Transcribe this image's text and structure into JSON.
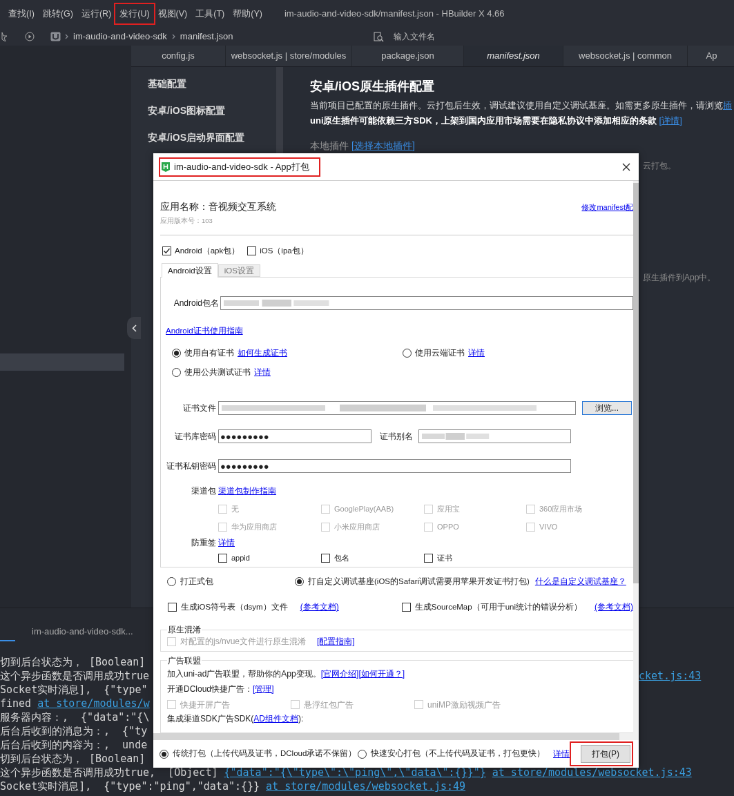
{
  "menu_bar": {
    "items": [
      {
        "label": "查找(I)",
        "highlighted": false
      },
      {
        "label": "跳转(G)",
        "highlighted": false
      },
      {
        "label": "运行(R)",
        "highlighted": false
      },
      {
        "label": "发行(U)",
        "highlighted": true
      },
      {
        "label": "视图(V)",
        "highlighted": false
      },
      {
        "label": "工具(T)",
        "highlighted": false
      },
      {
        "label": "帮助(Y)",
        "highlighted": false
      }
    ],
    "title": "im-audio-and-video-sdk/manifest.json - HBuilder X 4.66"
  },
  "toolbar": {
    "breadcrumb": [
      "im-audio-and-video-sdk",
      "manifest.json"
    ],
    "search": {
      "placeholder": "输入文件名"
    }
  },
  "editor_tabs": [
    {
      "label": "config.js",
      "selected": false
    },
    {
      "label": "websocket.js | store/modules",
      "selected": false
    },
    {
      "label": "package.json",
      "selected": false
    },
    {
      "label": "manifest.json",
      "selected": true
    },
    {
      "label": "websocket.js | common",
      "selected": false
    },
    {
      "label": "Ap",
      "selected": false
    }
  ],
  "settings_nav": {
    "items": [
      {
        "label": "基础配置"
      },
      {
        "label": "安卓/iOS图标配置"
      },
      {
        "label": "安卓/iOS启动界面配置"
      }
    ]
  },
  "content": {
    "heading": "安卓/iOS原生插件配置",
    "description": "当前项目已配置的原生插件。云打包后生效，调试建议使用自定义调试基座。如需更多原生插件，请浏览",
    "description_link": "插",
    "notice": "uni原生插件可能依赖三方SDK，上架到国内应用市场需要在隐私协议中添加相应的条款",
    "notice_link": "[详情]",
    "local_label": "本地插件",
    "local_link": "[选择本地插件]",
    "fragments": [
      "云打包。",
      "原生插件到App中。"
    ]
  },
  "console": {
    "tab": "im-audio-and-video-sdk...",
    "lines": [
      {
        "parts": [
          {
            "text": "切到后台状态为， [Boolean]",
            "link": false
          }
        ]
      },
      {
        "parts": [
          {
            "text": "这个异步函数是否调用成功true",
            "link": false
          }
        ],
        "right": {
          "text": "cket.js:43",
          "link": true
        }
      },
      {
        "parts": [
          {
            "text": "Socket实时消息],  {\"type\"",
            "link": false
          }
        ]
      },
      {
        "parts": [
          {
            "text": "fined",
            "link": false
          },
          {
            "text": "at store/modules/w",
            "link": true
          }
        ]
      },
      {
        "parts": [
          {
            "text": "服务器内容：,  {\"data\":\"{\\",
            "link": false
          }
        ]
      },
      {
        "parts": [
          {
            "text": "后台后收到的消息为：,  {\"ty",
            "link": false
          }
        ]
      },
      {
        "parts": [
          {
            "text": "后台后收到的内容为：,  unde",
            "link": false
          }
        ]
      },
      {
        "parts": [
          {
            "text": "切到后台状态为， [Boolean]",
            "link": false
          }
        ]
      },
      {
        "parts": [
          {
            "text": "这个异步函数是否调用成功true,  [Object]",
            "link": false
          },
          {
            "text": "{\"data\":\"{\\\"type\\\":\\\"ping\\\",\\\"data\\\":{}}\"}",
            "link": true
          },
          {
            "text": "at store/modules/websocket.js:43",
            "link": true
          }
        ]
      },
      {
        "parts": [
          {
            "text": "Socket实时消息],  {\"type\":\"ping\",\"data\":{}}",
            "link": false
          },
          {
            "text": "at store/modules/websocket.js:49",
            "link": true
          }
        ]
      }
    ]
  },
  "dialog": {
    "title": "im-audio-and-video-sdk - App打包",
    "title_highlighted": true,
    "app_name": "应用名称：音视频交互系统",
    "version": "应用版本号：103",
    "manifest_link": "修改manifest配",
    "platforms": [
      {
        "label": "Android（apk包）",
        "checked": true
      },
      {
        "label": "iOS（ipa包）",
        "checked": false
      }
    ],
    "tabs": [
      {
        "label": "Android设置",
        "selected": true
      },
      {
        "label": "iOS设置",
        "selected": false
      }
    ],
    "package_label": "Android包名",
    "cert_guide": "Android证书使用指南",
    "cert_options": [
      {
        "label": "使用自有证书",
        "link": "如何生成证书",
        "selected": true
      },
      {
        "label": "使用云端证书",
        "link": "详情",
        "selected": false
      },
      {
        "label": "使用公共测试证书",
        "link": "详情",
        "selected": false
      }
    ],
    "cert_file": {
      "label": "证书文件",
      "button": "浏览..."
    },
    "keystore_password": {
      "label": "证书库密码",
      "value": "●●●●●●●●●"
    },
    "alias_label": "证书别名",
    "key_password": {
      "label": "证书私钥密码",
      "value": "●●●●●●●●●"
    },
    "channels": {
      "label": "渠道包",
      "link": "渠道包制作指南",
      "items": [
        {
          "label": "无",
          "checked": false,
          "disabled": true
        },
        {
          "label": "GooglePlay(AAB)",
          "checked": false,
          "disabled": true
        },
        {
          "label": "应用宝",
          "checked": false,
          "disabled": true
        },
        {
          "label": "360应用市场",
          "checked": false,
          "disabled": true
        },
        {
          "label": "华为应用商店",
          "checked": false,
          "disabled": true
        },
        {
          "label": "小米应用商店",
          "checked": false,
          "disabled": true
        },
        {
          "label": "OPPO",
          "checked": false,
          "disabled": true
        },
        {
          "label": "VIVO",
          "checked": false,
          "disabled": true
        }
      ]
    },
    "resign": {
      "label": "防重签",
      "link": "详情",
      "items": [
        {
          "label": "appid",
          "checked": false
        },
        {
          "label": "包名",
          "checked": false
        },
        {
          "label": "证书",
          "checked": false
        }
      ]
    },
    "build_types": [
      {
        "label": "打正式包",
        "selected": false
      },
      {
        "label": "打自定义调试基座(iOS的Safari调试需要用苹果开发证书打包)",
        "selected": true
      }
    ],
    "build_help": "什么是自定义调试基座？",
    "options": [
      {
        "label": "生成iOS符号表（dsym）文件",
        "link": "(参考文档)",
        "checked": false
      },
      {
        "label": "生成SourceMap（可用于uni统计的错误分析）",
        "link": "(参考文档)",
        "checked": false
      }
    ],
    "obfuscation": {
      "legend": "原生混淆",
      "label": "对配置的js/nvue文件进行原生混淆",
      "link": "[配置指南]",
      "checked": false,
      "disabled": true
    },
    "ads": {
      "legend": "广告联盟",
      "intro": "加入uni-ad广告联盟，帮助你的App变现。",
      "links": [
        "[官网介绍]",
        "[如何开通？]"
      ],
      "dcloud": "开通DCloud快捷广告：",
      "dcloud_link": "[管理]",
      "items": [
        {
          "label": "快捷开屏广告",
          "checked": false,
          "disabled": true
        },
        {
          "label": "悬浮红包广告",
          "checked": false,
          "disabled": true
        },
        {
          "label": "uniMP激励视频广告",
          "checked": false,
          "disabled": true
        }
      ],
      "sdk_prefix": "集成渠道SDK广告SDK(",
      "sdk_link": "AD组件文档",
      "sdk_suffix": "):"
    },
    "modes": [
      {
        "label": "传统打包（上传代码及证书，DCloud承诺不保留）",
        "selected": true
      },
      {
        "label": "快速安心打包（不上传代码及证书，打包更快）",
        "selected": false
      }
    ],
    "details": "详情",
    "build_button": "打包(P)",
    "build_highlighted": true
  }
}
